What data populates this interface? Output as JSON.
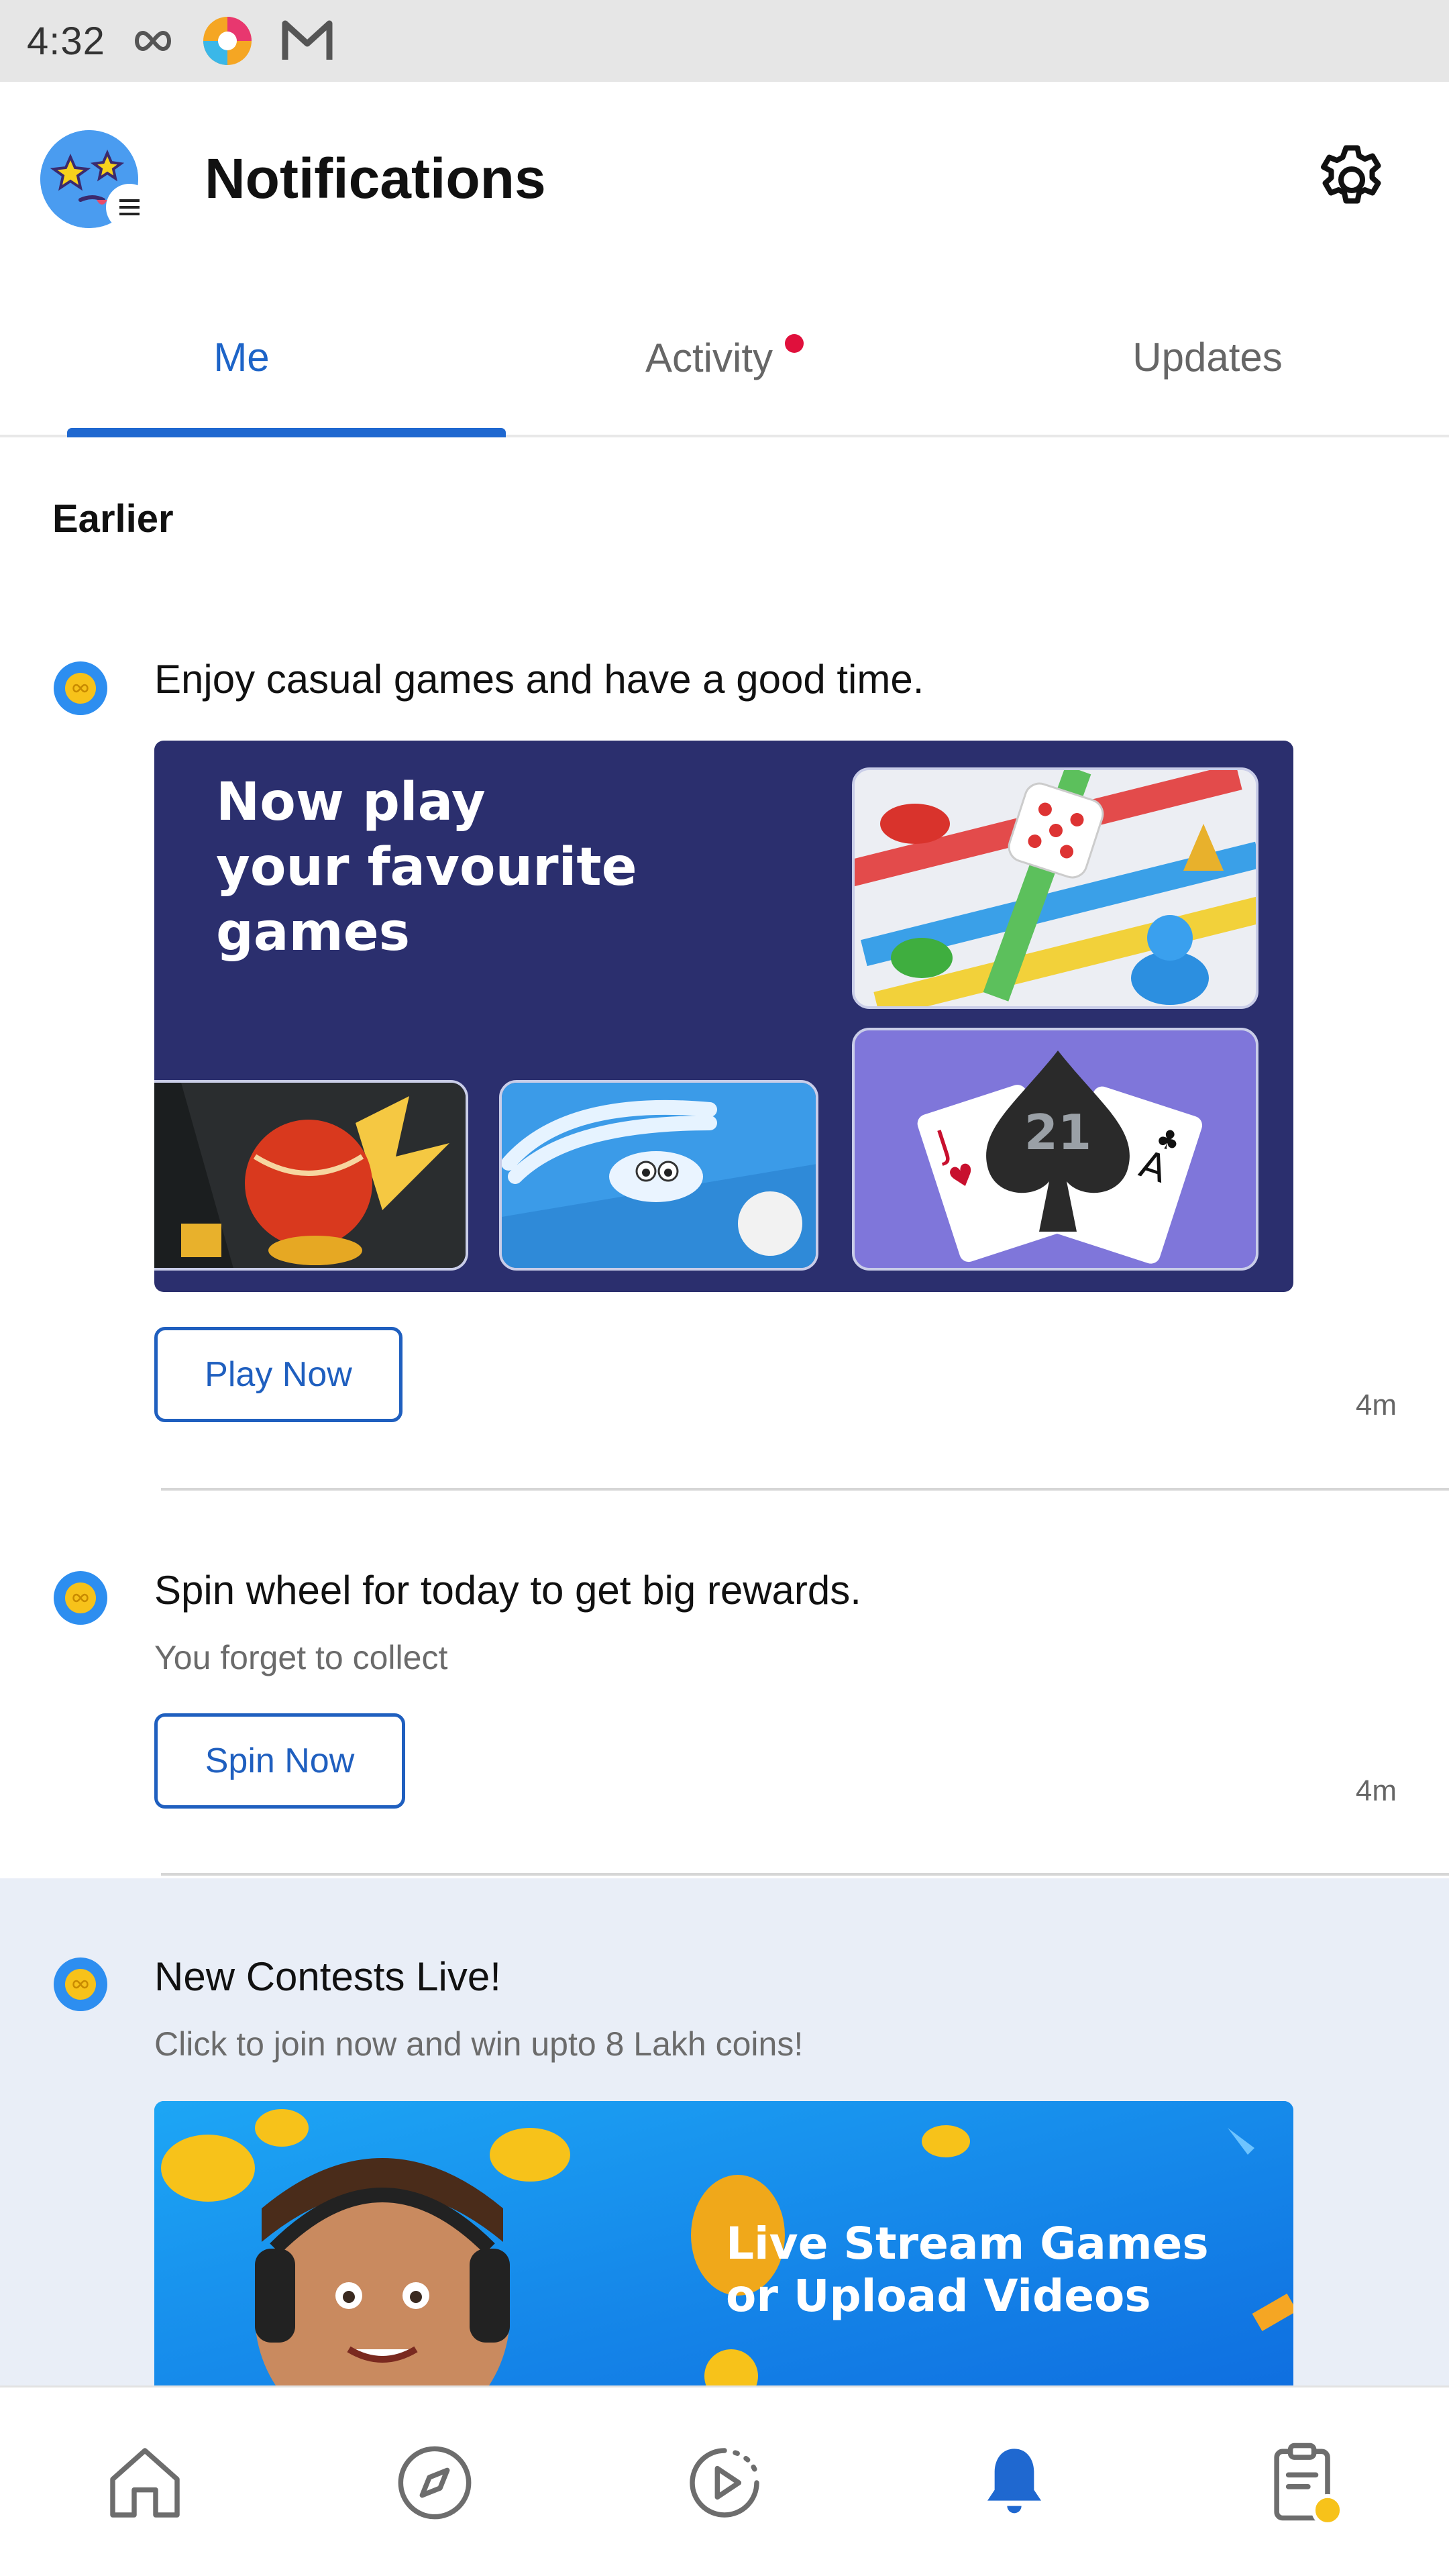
{
  "status_bar": {
    "time": "4:32",
    "icons": [
      "infinity-icon",
      "browser-app-icon",
      "mail-app-icon"
    ]
  },
  "header": {
    "title": "Notifications",
    "avatar_icon": "avatar",
    "settings_icon": "gear-icon"
  },
  "tabs": [
    {
      "label": "Me",
      "active": true
    },
    {
      "label": "Activity",
      "has_badge": true
    },
    {
      "label": "Updates"
    }
  ],
  "section_label": "Earlier",
  "notifications": [
    {
      "title": "Enjoy casual games and have a good time.",
      "banner_text": "Now play your favourite games",
      "banner_lines": [
        "Now play",
        "your favourite",
        "games"
      ],
      "card_21": "21",
      "button_label": "Play Now",
      "time": "4m"
    },
    {
      "title": "Spin wheel for today to get big rewards.",
      "subtitle": "You forget to collect",
      "button_label": "Spin Now",
      "time": "4m"
    },
    {
      "title": "New Contests Live!",
      "subtitle": "Click to join now and win upto 8 Lakh coins!",
      "banner_text": "Live Stream Games or Upload Videos",
      "banner_lines": [
        "Live Stream Games",
        "or Upload Videos"
      ]
    }
  ],
  "bottom_nav": [
    {
      "name": "home-icon"
    },
    {
      "name": "compass-icon"
    },
    {
      "name": "play-circle-icon"
    },
    {
      "name": "bell-icon",
      "active": true
    },
    {
      "name": "clipboard-coin-icon"
    }
  ],
  "colors": {
    "accent": "#1f68d0",
    "badge": "#e0103c",
    "banner_navy": "#2b2f6e",
    "banner_blue": "#1a8ff0",
    "highlight_bg": "#e9eef7"
  }
}
